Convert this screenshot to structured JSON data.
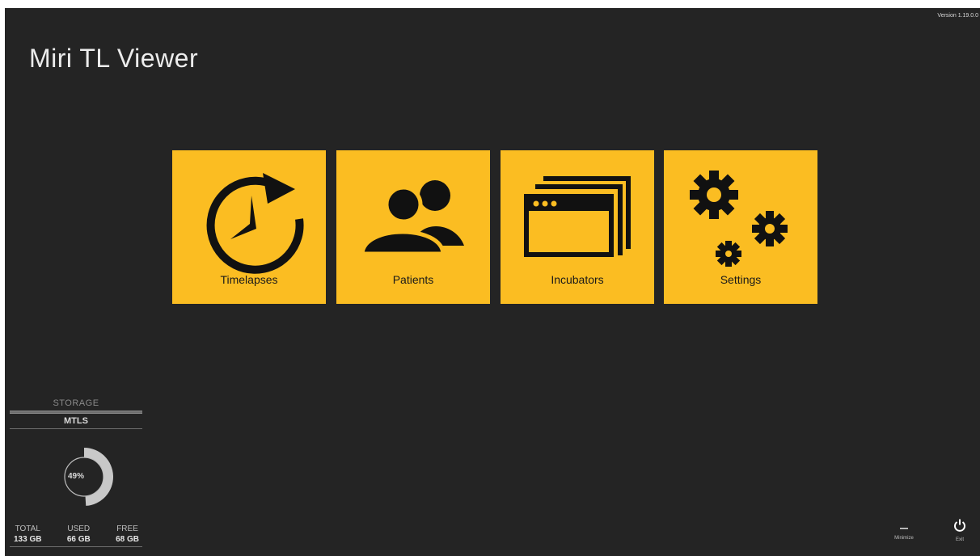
{
  "window": {
    "version": "Version 1.19.0.0",
    "title": "Miri TL Viewer"
  },
  "tiles": [
    {
      "label": "Timelapses",
      "icon": "clock-refresh-icon"
    },
    {
      "label": "Patients",
      "icon": "users-icon"
    },
    {
      "label": "Incubators",
      "icon": "windows-stack-icon"
    },
    {
      "label": "Settings",
      "icon": "gears-icon"
    }
  ],
  "storage": {
    "title": "STORAGE",
    "name": "MTLS",
    "percent": "49%",
    "used_fraction": 0.49,
    "stats": [
      {
        "label": "TOTAL",
        "value": "133 GB"
      },
      {
        "label": "USED",
        "value": "66 GB"
      },
      {
        "label": "FREE",
        "value": "68 GB"
      }
    ]
  },
  "controls": {
    "minimize_label": "Minimize",
    "exit_label": "Exit"
  },
  "colors": {
    "background": "#242424",
    "tile": "#fbbd22",
    "icon": "#111111",
    "donut": "#c8c8c8"
  }
}
